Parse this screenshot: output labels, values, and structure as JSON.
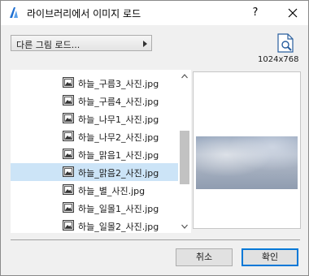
{
  "window": {
    "title": "라이브러리에서 이미지 로드",
    "help_label": "?",
    "colors": {
      "accent": "#0078d7",
      "selection": "#cce4f7",
      "app_icon": "#1f6fd1"
    }
  },
  "toolbar": {
    "dropdown_label": "다른 그림 로드..."
  },
  "preview": {
    "resolution": "1024x768"
  },
  "files": [
    {
      "name": "하늘_구름3_사진.jpg",
      "selected": false
    },
    {
      "name": "하늘_구름4_사진.jpg",
      "selected": false
    },
    {
      "name": "하늘_나무1_사진.jpg",
      "selected": false
    },
    {
      "name": "하늘_나무2_사진.jpg",
      "selected": false
    },
    {
      "name": "하늘_맑음1_사진.jpg",
      "selected": false
    },
    {
      "name": "하늘_맑음2_사진.jpg",
      "selected": true
    },
    {
      "name": "하늘_별_사진.jpg",
      "selected": false
    },
    {
      "name": "하늘_일몰1_사진.jpg",
      "selected": false
    },
    {
      "name": "하늘_일몰2_사진.jpg",
      "selected": false
    }
  ],
  "buttons": {
    "cancel_label": "취소",
    "ok_label": "확인"
  }
}
